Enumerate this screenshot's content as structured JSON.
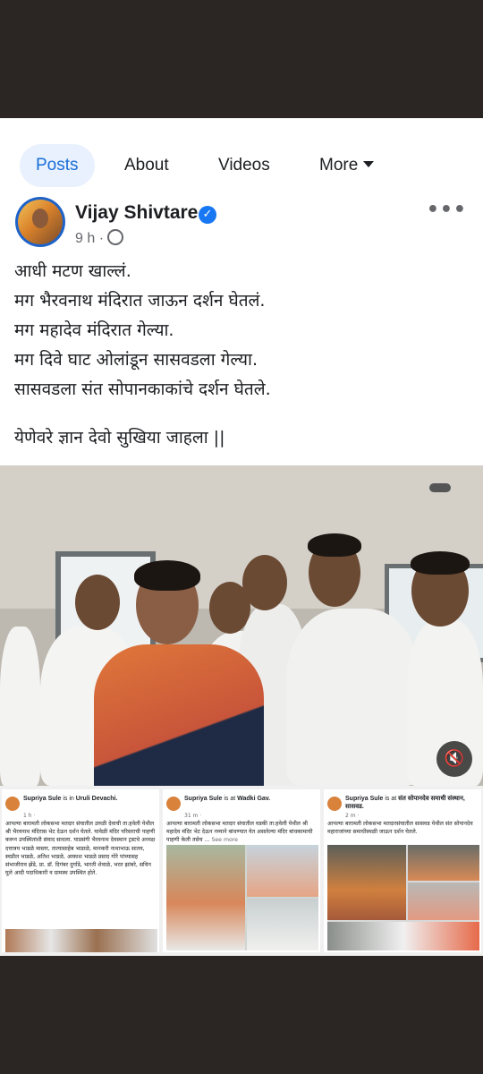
{
  "tabs": [
    {
      "label": "Posts",
      "active": true
    },
    {
      "label": "About",
      "active": false
    },
    {
      "label": "Videos",
      "active": false
    },
    {
      "label": "More",
      "active": false
    }
  ],
  "post": {
    "author": "Vijay Shivtare",
    "time": "9 h",
    "separator": "·",
    "verified_icon": "check-icon",
    "lines": [
      "आधी मटण खाल्लं.",
      "मग भैरवनाथ मंदिरात जाऊन दर्शन घेतलं.",
      "मग महादेव मंदिरात गेल्या.",
      "मग दिवे घाट ओलांडून सासवडला गेल्या.",
      "सासवडला संत सोपानकाकांचे दर्शन घेतले."
    ],
    "closing_line": "येणेवरे ज्ञान देवो सुखिया जाहला ||"
  },
  "video": {
    "mute_icon": "speaker-muted-icon"
  },
  "screenshots": [
    {
      "author": "Supriya Sule",
      "status": " is in ",
      "place": "Uruli Devachi.",
      "time": "1 h · ",
      "body": "आपल्या बारामती लोकसभा मतदार संघातील उरुळी देवाची ता:हवेली येथील श्री भैरवनाथ मंदिरास भेट देऊन दर्शन घेतले. यावेळी मंदिर परिसराची पाहणी करून उपस्थितांशी संवाद साधला. याप्रसंगी भैरवनाथ देवस्थान ट्रस्टचे अध्यक्ष दत्तात्रय भाडळे मास्तर, तात्यासाहेब भाडाळे, मानकरी नाथाभाऊ सातव, स्वप्नील भाडळे, अतिश भाडळे, आकाश भाडळे प्रसाद गोरे पांच्यासह संभाजीराव झेंडे, प्रा. डॉ. दिगंबर दुर्गाडे, भारती शेवाळे, भरत झांबरे, सचिन घुले आदी पदाधिकारी व ग्रामस्थ उपस्थित होते."
    },
    {
      "author": "Supriya Sule",
      "status": " is at ",
      "place": "Wadki Gav.",
      "time": "31 m · ",
      "body": "आपल्या बारामती लोकसभा मतदार संघातील वडकी ता:हवेली येथील श्री महादेव मंदिर भेट देऊन नव्याने बांधण्यात येत असलेल्या मंदिर बांधकामाची पाहणी केली तसेच ...",
      "see_more": "See more"
    },
    {
      "author": "Supriya Sule",
      "status": " is at ",
      "place": "संत सोपानदेव समाधी संस्थान, सासवड.",
      "time": "2 m · ",
      "body": "आपल्या बारामती लोकसभा मतदारसंघातील सासवड येथील संत सोपानदेव महाराजांच्या समाधीस्थळी जाऊन दर्शन घेतले."
    }
  ],
  "colors": {
    "accent": "#1877f2",
    "tab_active_bg": "#e8f1fd",
    "frame": "#2b2523"
  }
}
